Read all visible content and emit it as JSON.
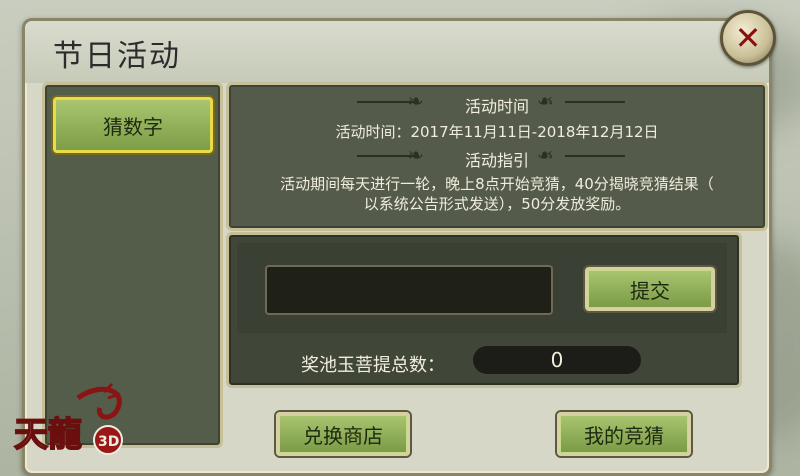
{
  "window": {
    "title": "节日活动"
  },
  "sidebar": {
    "items": [
      {
        "label": "猜数字",
        "selected": true
      }
    ]
  },
  "info": {
    "time_heading": "活动时间",
    "time_text": "活动时间：2017年11月11日-2018年12月12日",
    "guide_heading": "活动指引",
    "guide_line1": "活动期间每天进行一轮，晚上8点开始竞猜，40分揭晓竞猜结果（",
    "guide_line2": "以系统公告形式发送），50分发放奖励。"
  },
  "guess": {
    "input_value": "",
    "submit_label": "提交",
    "pool_label": "奖池玉菩提总数：",
    "pool_value": "0"
  },
  "buttons": {
    "shop": "兑换商店",
    "my_guess": "我的竞猜"
  },
  "logo": {
    "text": "天龍",
    "badge": "3D"
  },
  "colors": {
    "accent_green": "#8fb057",
    "selected_border": "#e9dc4a",
    "panel": "#545b4a",
    "close_x": "#8a1010"
  }
}
